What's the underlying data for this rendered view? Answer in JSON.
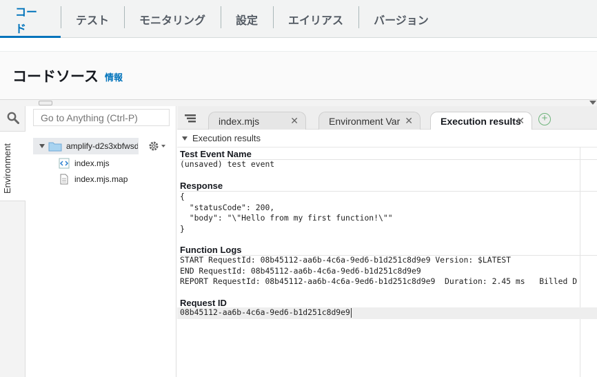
{
  "top_tabs": [
    "コード",
    "テスト",
    "モニタリング",
    "設定",
    "エイリアス",
    "バージョン"
  ],
  "header": {
    "title": "コードソース",
    "info_link": "情報"
  },
  "left_rail": {
    "environment_label": "Environment"
  },
  "file_panel": {
    "search_placeholder": "Go to Anything (Ctrl-P)",
    "folder": "amplify-d2s3xbfwsd",
    "files": [
      "index.mjs",
      "index.mjs.map"
    ]
  },
  "editor_tabs": [
    {
      "label": "index.mjs"
    },
    {
      "label": "Environment Var"
    },
    {
      "label": "Execution results"
    }
  ],
  "results": {
    "header": "Execution results",
    "test_event_label": "Test Event Name",
    "test_event_value": "(unsaved) test event",
    "response_label": "Response",
    "response_lines": [
      "{",
      "  \"statusCode\": 200,",
      "  \"body\": \"\\\"Hello from my first function!\\\"\"",
      "}"
    ],
    "function_logs_label": "Function Logs",
    "log_lines": [
      "START RequestId: 08b45112-aa6b-4c6a-9ed6-b1d251c8d9e9 Version: $LATEST",
      "END RequestId: 08b45112-aa6b-4c6a-9ed6-b1d251c8d9e9",
      "REPORT RequestId: 08b45112-aa6b-4c6a-9ed6-b1d251c8d9e9  Duration: 2.45 ms   Billed D"
    ],
    "request_id_label": "Request ID",
    "request_id_value": "08b45112-aa6b-4c6a-9ed6-b1d251c8d9e9"
  },
  "colors": {
    "accent": "#0073bb",
    "add_tab": "#6db37a"
  }
}
